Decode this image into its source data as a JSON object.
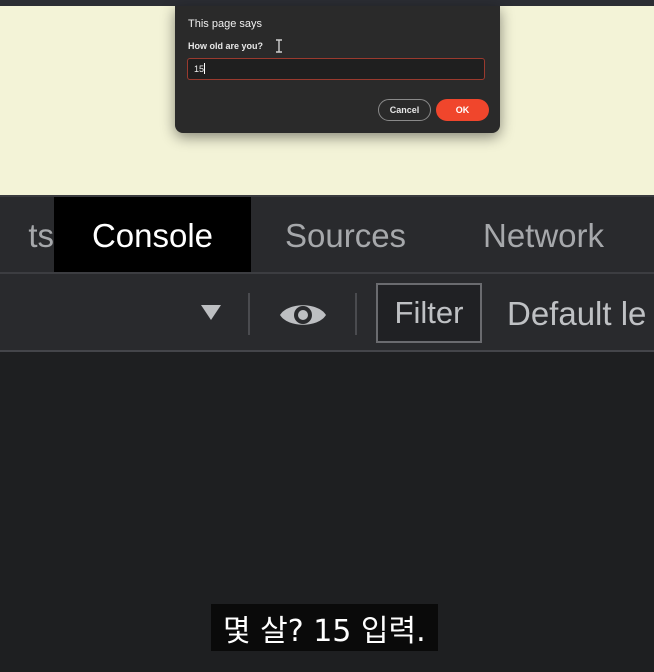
{
  "dialog": {
    "title": "This page says",
    "message": "How old are you?",
    "input_value": "15",
    "cancel_label": "Cancel",
    "ok_label": "OK",
    "ok_color": "#f0462c"
  },
  "devtools": {
    "tabs": [
      {
        "label": "ts",
        "selected": false
      },
      {
        "label": "Console",
        "selected": true
      },
      {
        "label": "Sources",
        "selected": false
      },
      {
        "label": "Network",
        "selected": false
      }
    ],
    "toolbar": {
      "filter_label": "Filter",
      "levels_label": "Default le",
      "icons": [
        "dropdown-arrow-icon",
        "eye-icon"
      ]
    }
  },
  "subtitle": "몇 살? 15 입력."
}
